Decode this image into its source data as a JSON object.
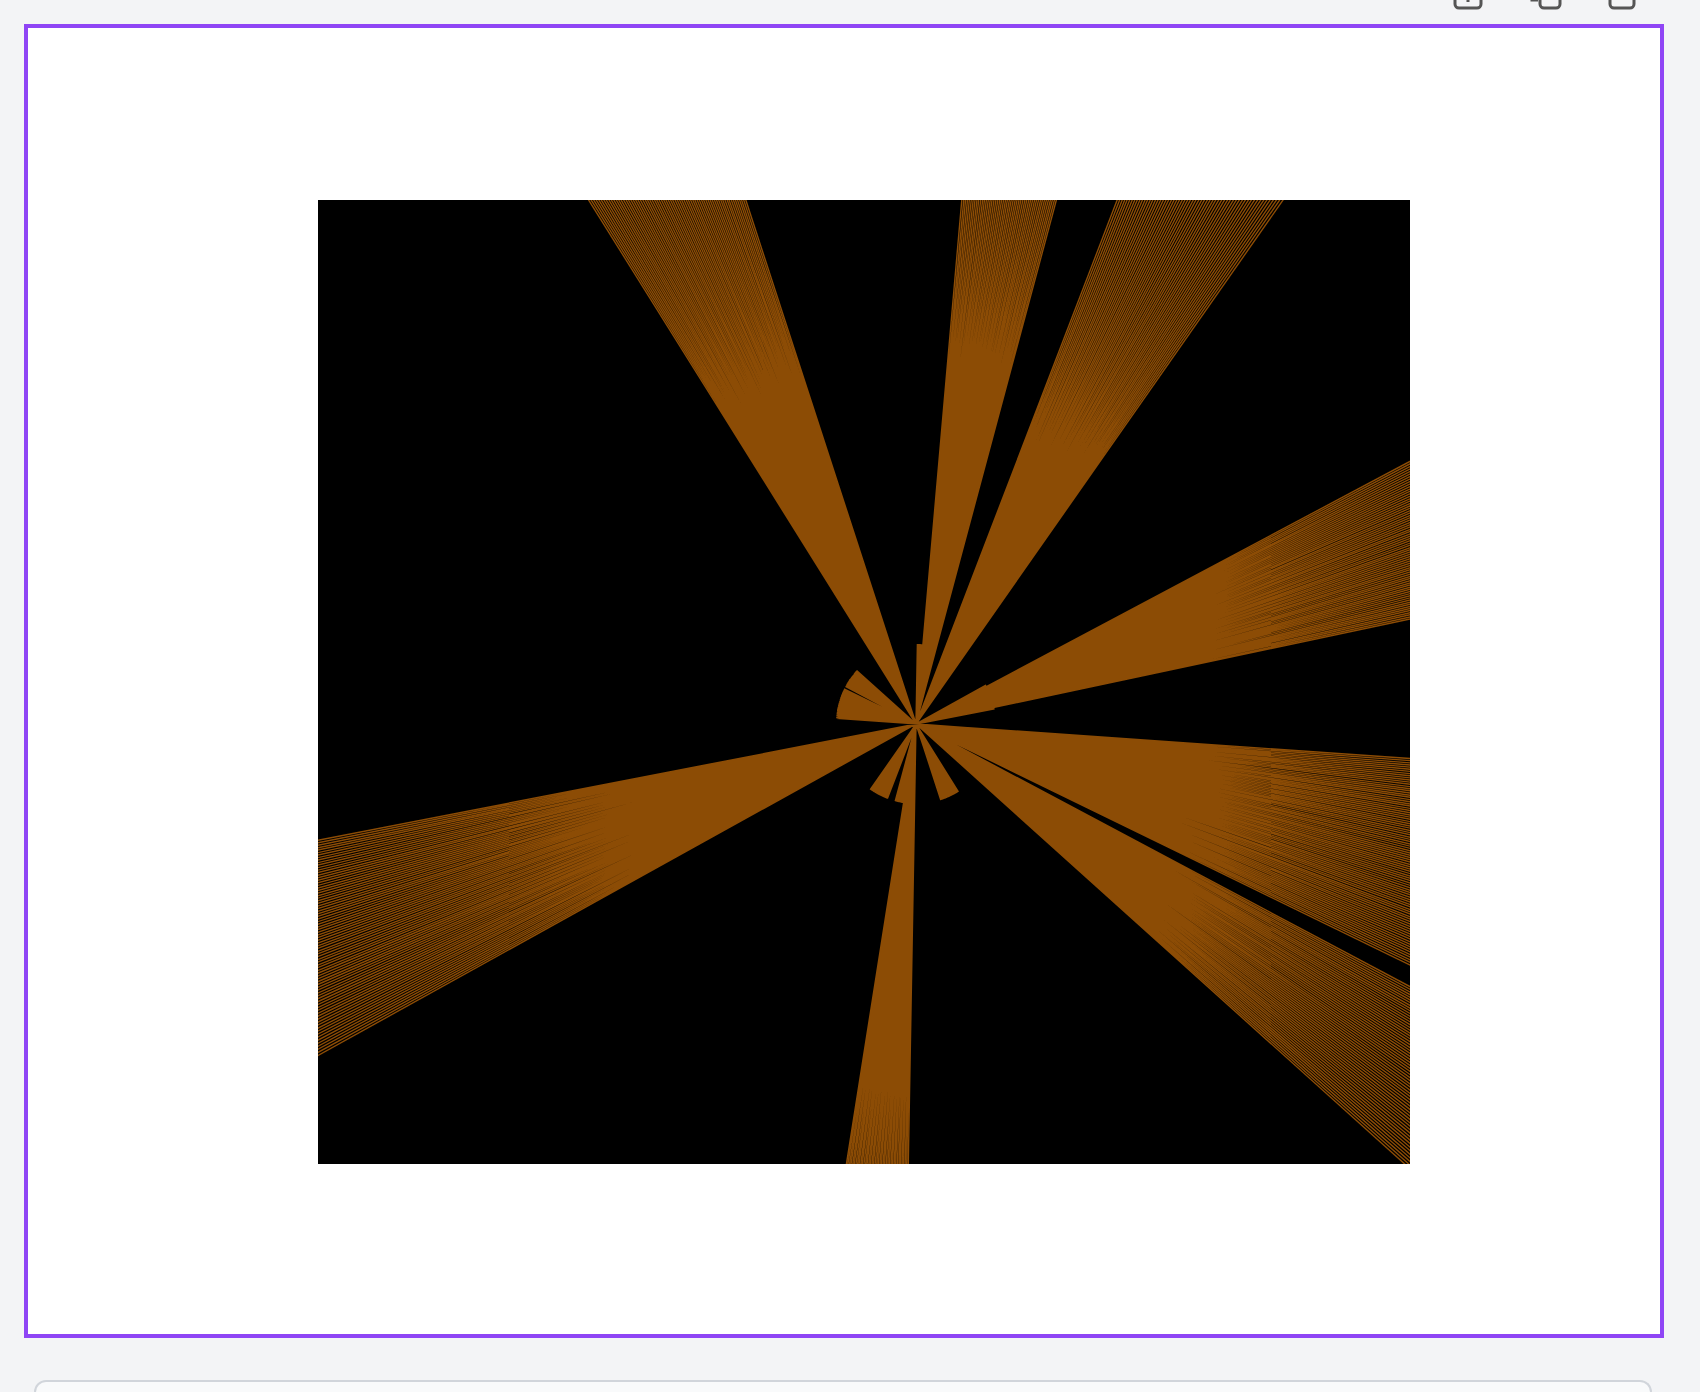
{
  "frame": {
    "selected": true
  }
}
